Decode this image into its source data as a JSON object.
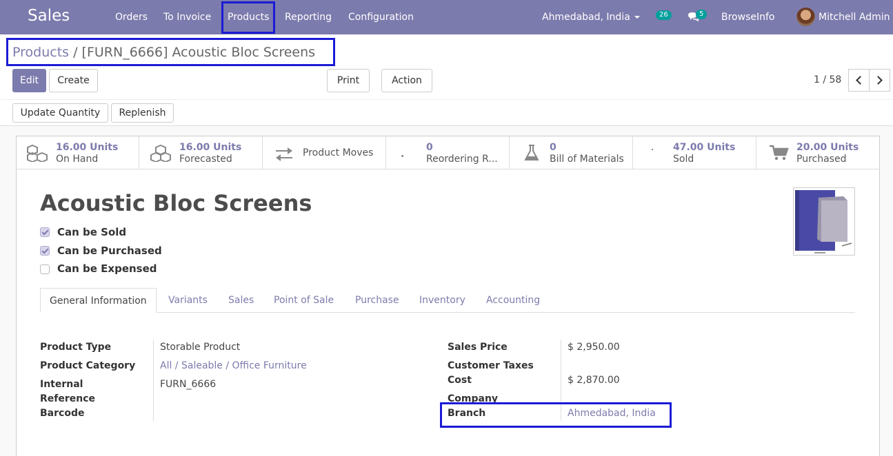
{
  "navbar": {
    "app_title": "Sales",
    "menus": [
      "Orders",
      "To Invoice",
      "Products",
      "Reporting",
      "Configuration"
    ],
    "branch": "Ahmedabad, India",
    "activity_count": "26",
    "message_count": "5",
    "company": "BrowseInfo",
    "user": "Mitchell Admin"
  },
  "breadcrumb": {
    "parent": "Products",
    "separator": "/",
    "current": "[FURN_6666] Acoustic Bloc Screens"
  },
  "buttons": {
    "edit": "Edit",
    "create": "Create",
    "print": "Print",
    "action": "Action",
    "update_quantity": "Update Quantity",
    "replenish": "Replenish"
  },
  "pager": "1 / 58",
  "stats": [
    {
      "value": "16.00 Units",
      "label": "On Hand",
      "icon": "cubes-icon"
    },
    {
      "value": "16.00 Units",
      "label": "Forecasted",
      "icon": "cubes-icon"
    },
    {
      "value": "",
      "label": "Product Moves",
      "icon": "exchange-icon"
    },
    {
      "value": "0",
      "label": "Reordering R...",
      "icon": "refresh-icon"
    },
    {
      "value": "0",
      "label": "Bill of Materials",
      "icon": "flask-icon"
    },
    {
      "value": "47.00 Units",
      "label": "Sold",
      "icon": "signal-icon"
    },
    {
      "value": "20.00 Units",
      "label": "Purchased",
      "icon": "cart-icon"
    }
  ],
  "product": {
    "name": "Acoustic Bloc Screens",
    "can_be_sold": {
      "label": "Can be Sold",
      "checked": true
    },
    "can_be_purchased": {
      "label": "Can be Purchased",
      "checked": true
    },
    "can_be_expensed": {
      "label": "Can be Expensed",
      "checked": false
    }
  },
  "tabs": [
    "General Information",
    "Variants",
    "Sales",
    "Point of Sale",
    "Purchase",
    "Inventory",
    "Accounting"
  ],
  "left_fields": {
    "product_type": {
      "label": "Product Type",
      "value": "Storable Product"
    },
    "product_category": {
      "label": "Product Category",
      "value": "All / Saleable / Office Furniture"
    },
    "internal_reference": {
      "label_1": "Internal",
      "label_2": "Reference",
      "value": "FURN_6666"
    },
    "barcode": {
      "label": "Barcode",
      "value": ""
    }
  },
  "right_fields": {
    "sales_price": {
      "label": "Sales Price",
      "value": "$ 2,950.00"
    },
    "customer_taxes": {
      "label": "Customer Taxes",
      "value": ""
    },
    "cost": {
      "label": "Cost",
      "value": "$ 2,870.00"
    },
    "company": {
      "label": "Company",
      "value": ""
    },
    "branch": {
      "label": "Branch",
      "value": "Ahmedabad, India"
    }
  },
  "colors": {
    "brand": "#7c7bad",
    "highlight": "#1a1ad6",
    "badge": "#00a09d"
  }
}
